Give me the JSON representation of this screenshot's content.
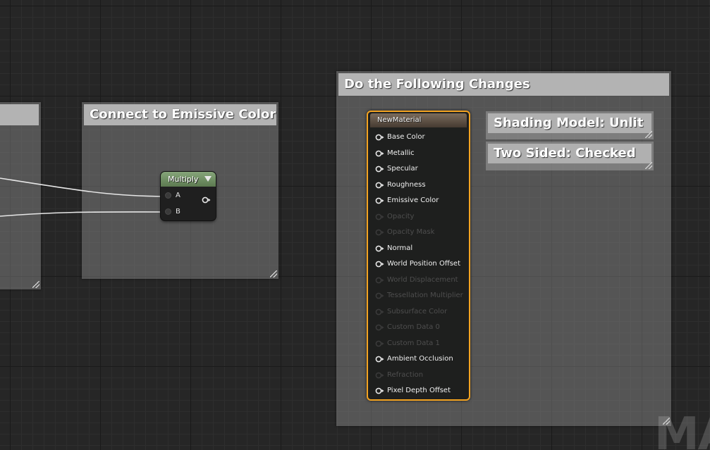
{
  "comments": {
    "left_partial": {
      "title": ""
    },
    "connect": {
      "title": "Connect to Emissive Color"
    },
    "changes": {
      "title": "Do the Following Changes"
    }
  },
  "multiply_node": {
    "title": "Multiply",
    "inputs": [
      {
        "label": "A"
      },
      {
        "label": "B"
      }
    ]
  },
  "material_node": {
    "title": "NewMaterial",
    "pins": [
      {
        "label": "Base Color",
        "active": true
      },
      {
        "label": "Metallic",
        "active": true
      },
      {
        "label": "Specular",
        "active": true
      },
      {
        "label": "Roughness",
        "active": true
      },
      {
        "label": "Emissive Color",
        "active": true
      },
      {
        "label": "Opacity",
        "active": false
      },
      {
        "label": "Opacity Mask",
        "active": false
      },
      {
        "label": "Normal",
        "active": true
      },
      {
        "label": "World Position Offset",
        "active": true
      },
      {
        "label": "World Displacement",
        "active": false
      },
      {
        "label": "Tessellation Multiplier",
        "active": false
      },
      {
        "label": "Subsurface Color",
        "active": false
      },
      {
        "label": "Custom Data 0",
        "active": false
      },
      {
        "label": "Custom Data 1",
        "active": false
      },
      {
        "label": "Ambient Occlusion",
        "active": true
      },
      {
        "label": "Refraction",
        "active": false
      },
      {
        "label": "Pixel Depth Offset",
        "active": true
      }
    ]
  },
  "settings": [
    {
      "label": "Shading Model: Unlit"
    },
    {
      "label": "Two Sided: Checked"
    }
  ],
  "watermark": {
    "text": "MA"
  },
  "colors": {
    "graph_background": "#262626",
    "material_border": "#f4a321",
    "multiply_header": "#6f8f63",
    "comment_header": "#b3b3b3"
  },
  "icons": {
    "material_pin": "output-pin-icon",
    "multiply_output": "output-pin-icon",
    "multiply_dropdown": "dropdown-arrow-icon"
  }
}
